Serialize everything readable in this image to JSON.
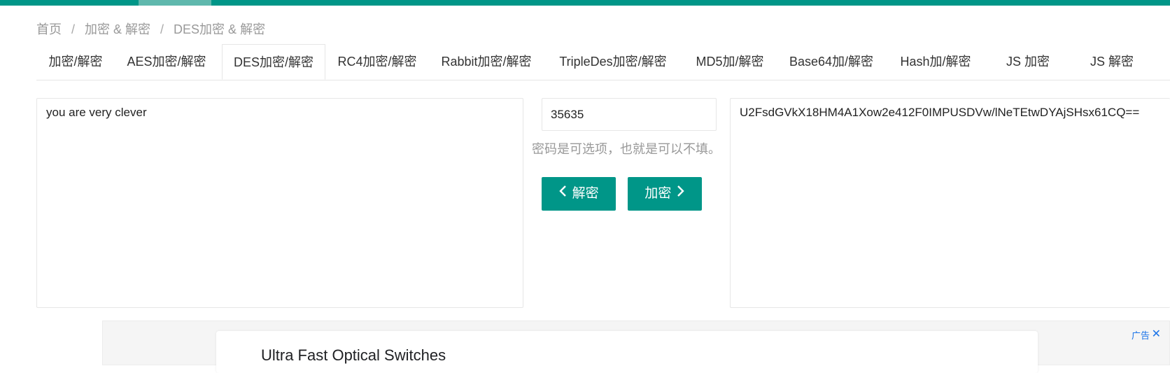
{
  "breadcrumb": {
    "items": [
      "首页",
      "加密 & 解密",
      "DES加密 & 解密"
    ],
    "separator": "/"
  },
  "tabs": [
    {
      "label": "加密/解密"
    },
    {
      "label": "AES加密/解密"
    },
    {
      "label": "DES加密/解密"
    },
    {
      "label": "RC4加密/解密"
    },
    {
      "label": "Rabbit加密/解密"
    },
    {
      "label": "TripleDes加密/解密"
    },
    {
      "label": "MD5加/解密"
    },
    {
      "label": "Base64加/解密"
    },
    {
      "label": "Hash加/解密"
    },
    {
      "label": "JS 加密"
    },
    {
      "label": "JS 解密"
    }
  ],
  "active_tab": "DES加密/解密",
  "plaintext": "you are very clever",
  "password": {
    "value": "35635",
    "hint": "密码是可选项，也就是可以不填。"
  },
  "buttons": {
    "decrypt_label": "解密",
    "encrypt_label": "加密"
  },
  "ciphertext": "U2FsdGVkX18HM4A1Xow2e412F0IMPUSDVw/lNeTEtwDYAjSHsx61CQ==",
  "ad": {
    "title": "Ultra Fast Optical Switches",
    "label": "广告"
  },
  "colors": {
    "accent": "#009688",
    "accent_light": "#5fb8ad",
    "muted_text": "#999999",
    "ad_link": "#1a73e8"
  }
}
